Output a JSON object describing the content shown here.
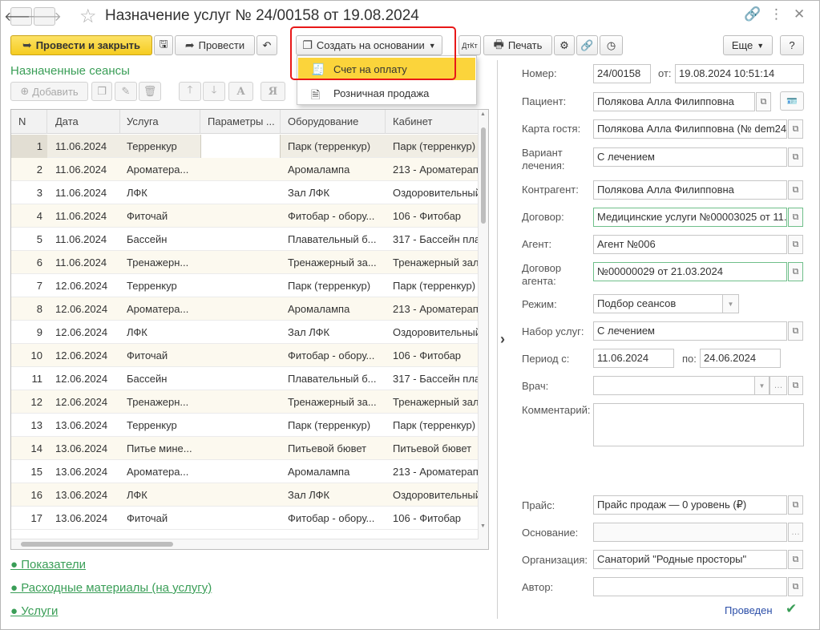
{
  "window": {
    "title": "Назначение услуг № 24/00158 от 19.08.2024",
    "icons": [
      "link-icon",
      "more-icon",
      "close-icon"
    ]
  },
  "toolbar": {
    "post_close": "Провести и закрыть",
    "post": "Провести",
    "create_based": "Создать на основании",
    "print": "Печать",
    "more": "Еще",
    "help": "?"
  },
  "dropdown": {
    "items": [
      "Счет на оплату",
      "Розничная продажа"
    ]
  },
  "sessions": {
    "title": "Назначенные сеансы",
    "add": "Добавить",
    "columns": [
      "N",
      "Дата",
      "Услуга",
      "Параметры ...",
      "Оборудование",
      "Кабинет"
    ],
    "rows": [
      {
        "n": "1",
        "date": "11.06.2024",
        "service": "Терренкур",
        "params": "",
        "equipment": "Парк (терренкур)",
        "room": "Парк (терренкур)"
      },
      {
        "n": "2",
        "date": "11.06.2024",
        "service": "Ароматера...",
        "params": "",
        "equipment": "Аромалампа",
        "room": "213 - Ароматерапия"
      },
      {
        "n": "3",
        "date": "11.06.2024",
        "service": "ЛФК",
        "params": "",
        "equipment": "Зал ЛФК",
        "room": "Оздоровительный"
      },
      {
        "n": "4",
        "date": "11.06.2024",
        "service": "Фиточай",
        "params": "",
        "equipment": "Фитобар - обору...",
        "room": "106 - Фитобар"
      },
      {
        "n": "5",
        "date": "11.06.2024",
        "service": "Бассейн",
        "params": "",
        "equipment": "Плавательный б...",
        "room": "317 - Бассейн пла"
      },
      {
        "n": "6",
        "date": "11.06.2024",
        "service": "Тренажерн...",
        "params": "",
        "equipment": "Тренажерный за...",
        "room": "Тренажерный зал"
      },
      {
        "n": "7",
        "date": "12.06.2024",
        "service": "Терренкур",
        "params": "",
        "equipment": "Парк (терренкур)",
        "room": "Парк (терренкур)"
      },
      {
        "n": "8",
        "date": "12.06.2024",
        "service": "Ароматера...",
        "params": "",
        "equipment": "Аромалампа",
        "room": "213 - Ароматерапия"
      },
      {
        "n": "9",
        "date": "12.06.2024",
        "service": "ЛФК",
        "params": "",
        "equipment": "Зал ЛФК",
        "room": "Оздоровительный"
      },
      {
        "n": "10",
        "date": "12.06.2024",
        "service": "Фиточай",
        "params": "",
        "equipment": "Фитобар - обору...",
        "room": "106 - Фитобар"
      },
      {
        "n": "11",
        "date": "12.06.2024",
        "service": "Бассейн",
        "params": "",
        "equipment": "Плавательный б...",
        "room": "317 - Бассейн пла"
      },
      {
        "n": "12",
        "date": "12.06.2024",
        "service": "Тренажерн...",
        "params": "",
        "equipment": "Тренажерный за...",
        "room": "Тренажерный зал"
      },
      {
        "n": "13",
        "date": "13.06.2024",
        "service": "Терренкур",
        "params": "",
        "equipment": "Парк (терренкур)",
        "room": "Парк (терренкур)"
      },
      {
        "n": "14",
        "date": "13.06.2024",
        "service": "Питье мине...",
        "params": "",
        "equipment": "Питьевой бювет",
        "room": "Питьевой бювет"
      },
      {
        "n": "15",
        "date": "13.06.2024",
        "service": "Ароматера...",
        "params": "",
        "equipment": "Аромалампа",
        "room": "213 - Ароматерапия"
      },
      {
        "n": "16",
        "date": "13.06.2024",
        "service": "ЛФК",
        "params": "",
        "equipment": "Зал ЛФК",
        "room": "Оздоровительный"
      },
      {
        "n": "17",
        "date": "13.06.2024",
        "service": "Фиточай",
        "params": "",
        "equipment": "Фитобар - обору...",
        "room": "106 - Фитобар"
      }
    ]
  },
  "links": [
    "● Показатели",
    "● Расходные материалы (на услугу)",
    "● Услуги"
  ],
  "form": {
    "number_label": "Номер:",
    "number": "24/00158",
    "from_label": "от:",
    "date": "19.08.2024 10:51:14",
    "patient_label": "Пациент:",
    "patient": "Полякова Алла Филипповна",
    "card_label": "Карта гостя:",
    "card": "Полякова Алла Филипповна (№ dem24",
    "variant_label": "Вариант лечения:",
    "variant": "С лечением",
    "contractor_label": "Контрагент:",
    "contractor": "Полякова Алла Филипповна",
    "contract_label": "Договор:",
    "contract": "Медицинские услуги №00003025 от 11.",
    "agent_label": "Агент:",
    "agent": "Агент №006",
    "agent_contract_label": "Договор агента:",
    "agent_contract": "№00000029 от 21.03.2024",
    "mode_label": "Режим:",
    "mode": "Подбор сеансов",
    "set_label": "Набор услуг:",
    "set": "С лечением",
    "period_label": "Период с:",
    "period_from": "11.06.2024",
    "period_to_label": "по:",
    "period_to": "24.06.2024",
    "doctor_label": "Врач:",
    "doctor": "",
    "comment_label": "Комментарий:",
    "comment": "",
    "price_label": "Прайс:",
    "price": "Прайс продаж — 0 уровень (₽)",
    "basis_label": "Основание:",
    "basis": "",
    "org_label": "Организация:",
    "org": "Санаторий \"Родные просторы\"",
    "author_label": "Автор:",
    "author": "",
    "status": "Проведен"
  }
}
